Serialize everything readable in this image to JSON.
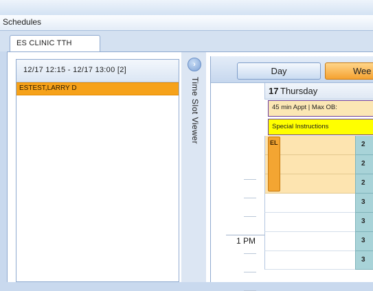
{
  "window": {
    "title": "Schedules"
  },
  "tabs": [
    {
      "label": "ES CLINIC TTH"
    }
  ],
  "slot_panel": {
    "header": "12/17 12:15 - 12/17 13:00  [2]",
    "patients": [
      {
        "name": "ESTEST,LARRY D"
      }
    ]
  },
  "viewer": {
    "label": "Time Slot Viewer",
    "icon": "chevron-right-icon"
  },
  "scheduler": {
    "view_buttons": {
      "day": "Day",
      "week": "Wee"
    },
    "day_number": "17",
    "day_name": "Thursday",
    "info_text": "45 min Appt | Max OB:",
    "instructions_text": "Special Instructions",
    "time_label": "1 PM",
    "appointment_label": "EL",
    "slot_counts": [
      "2",
      "2",
      "2",
      "3",
      "3",
      "3",
      "3"
    ]
  },
  "colors": {
    "accent": "#f6a21a",
    "info_band": "#fbe6b4",
    "instructions_band": "#ffff00",
    "count_cell": "#a8d3d8"
  }
}
